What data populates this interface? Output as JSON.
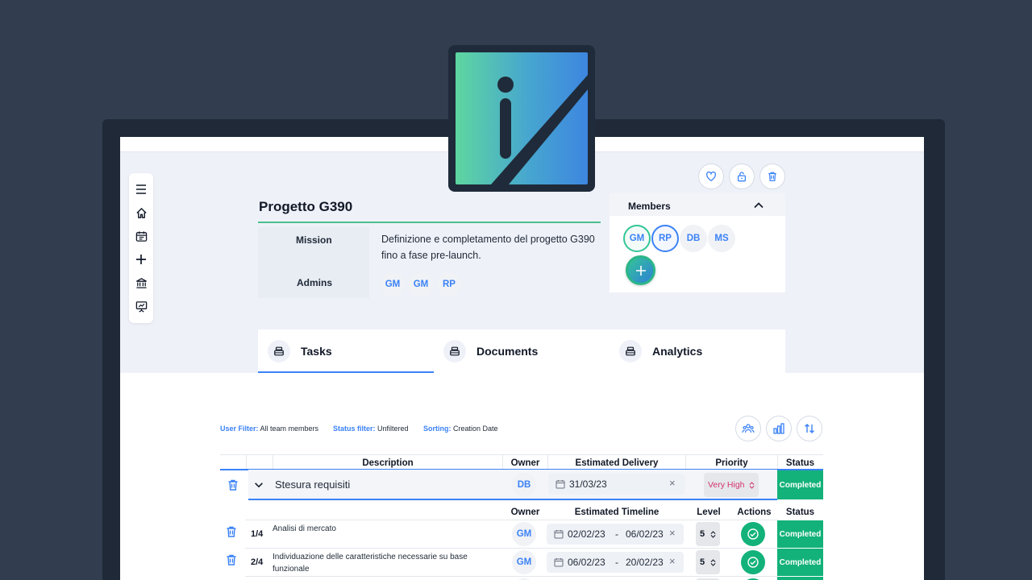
{
  "project": {
    "title": "Progetto G390",
    "mission_label": "Mission",
    "mission_text": "Definizione e completamento del progetto G390 fino a fase pre-launch.",
    "admins_label": "Admins",
    "admins": [
      "GM",
      "GM",
      "RP"
    ]
  },
  "members": {
    "title": "Members",
    "list": [
      "GM",
      "RP",
      "DB",
      "MS"
    ]
  },
  "tabs": [
    {
      "label": "Tasks",
      "active": true
    },
    {
      "label": "Documents",
      "active": false
    },
    {
      "label": "Analytics",
      "active": false
    }
  ],
  "filters": {
    "user_key": "User Filter:",
    "user_val": "All team members",
    "status_key": "Status filter:",
    "status_val": "Unfiltered",
    "sort_key": "Sorting:",
    "sort_val": "Creation Date"
  },
  "table": {
    "headers": {
      "description": "Description",
      "owner": "Owner",
      "delivery": "Estimated Delivery",
      "priority": "Priority",
      "status": "Status"
    },
    "task": {
      "title": "Stesura requisiti",
      "owner": "DB",
      "delivery": "31/03/23",
      "priority": "Very High",
      "status": "Completed"
    },
    "sub_headers": {
      "owner": "Owner",
      "timeline": "Estimated Timeline",
      "level": "Level",
      "actions": "Actions",
      "status": "Status"
    },
    "subtasks": [
      {
        "index": "1/4",
        "text": "Analisi di mercato",
        "owner": "GM",
        "start": "02/02/23",
        "end": "06/02/23",
        "level": "5",
        "status": "Completed"
      },
      {
        "index": "2/4",
        "text": "Individuazione delle caratteristiche necessarie su base funzionale",
        "owner": "GM",
        "start": "06/02/23",
        "end": "20/02/23",
        "level": "5",
        "status": "Completed"
      }
    ]
  },
  "colors": {
    "accent_blue": "#3b82f6",
    "success_green": "#13b27a",
    "priority_pink": "#d6336c",
    "backdrop": "#323e4f"
  }
}
